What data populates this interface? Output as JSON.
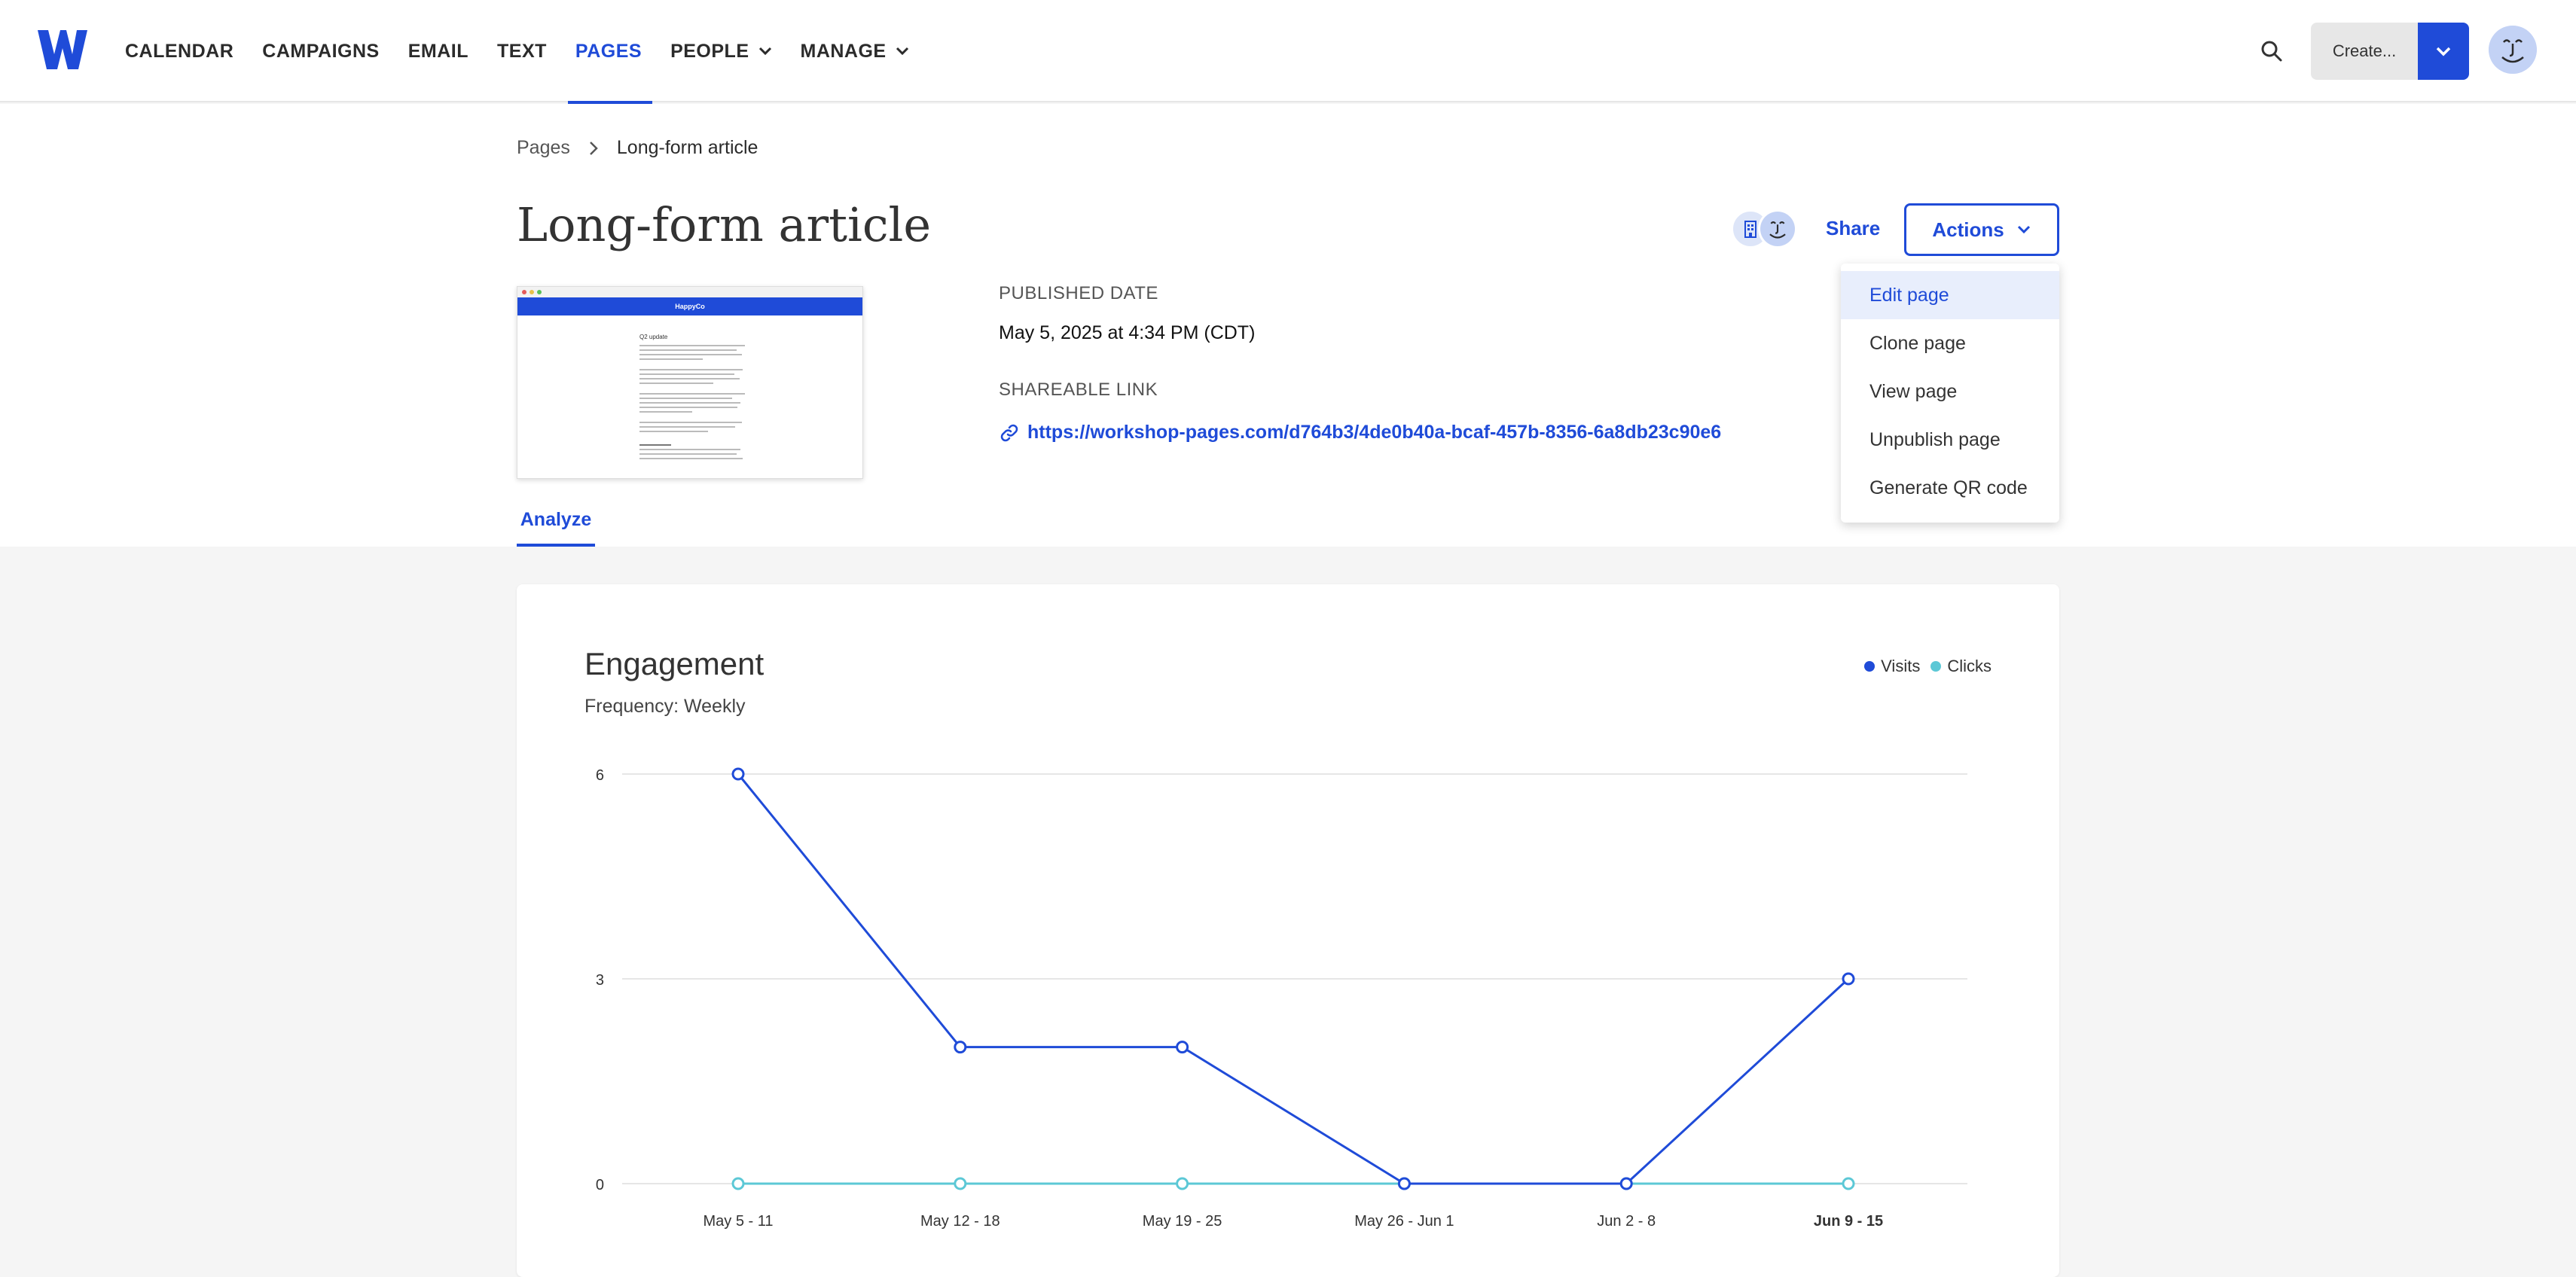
{
  "nav": {
    "items": [
      {
        "label": "CALENDAR",
        "dropdown": false,
        "active": false
      },
      {
        "label": "CAMPAIGNS",
        "dropdown": false,
        "active": false
      },
      {
        "label": "EMAIL",
        "dropdown": false,
        "active": false
      },
      {
        "label": "TEXT",
        "dropdown": false,
        "active": false
      },
      {
        "label": "PAGES",
        "dropdown": false,
        "active": true
      },
      {
        "label": "PEOPLE",
        "dropdown": true,
        "active": false
      },
      {
        "label": "MANAGE",
        "dropdown": true,
        "active": false
      }
    ],
    "create_label": "Create...",
    "search_icon": "search-icon",
    "accent": "#1f4bd8"
  },
  "breadcrumb": {
    "root": "Pages",
    "current": "Long-form article"
  },
  "page": {
    "title": "Long-form article",
    "thumbnail": {
      "brand": "HappyCo",
      "heading": "Q2 update"
    },
    "published_label": "PUBLISHED DATE",
    "published_value": "May 5, 2025 at 4:34 PM (CDT)",
    "link_label": "SHAREABLE LINK",
    "link_value": "https://workshop-pages.com/d764b3/4de0b40a-bcaf-457b-8356-6a8db23c90e6"
  },
  "toolbar": {
    "share_label": "Share",
    "actions_label": "Actions"
  },
  "actions_menu": [
    {
      "label": "Edit page",
      "active": true
    },
    {
      "label": "Clone page",
      "active": false
    },
    {
      "label": "View page",
      "active": false
    },
    {
      "label": "Unpublish page",
      "active": false
    },
    {
      "label": "Generate QR code",
      "active": false
    }
  ],
  "tabs": [
    {
      "label": "Analyze",
      "active": true
    }
  ],
  "engagement": {
    "title": "Engagement",
    "subtitle": "Frequency: Weekly"
  },
  "chart_data": {
    "type": "line",
    "categories": [
      "May 5 - 11",
      "May 12 - 18",
      "May 19 - 25",
      "May 26 - Jun 1",
      "Jun 2 - 8",
      "Jun 9 - 15"
    ],
    "series": [
      {
        "name": "Visits",
        "values": [
          6,
          2,
          2,
          0,
          0,
          3
        ],
        "color": "#1f4bd8"
      },
      {
        "name": "Clicks",
        "values": [
          0,
          0,
          0,
          0,
          0,
          0
        ],
        "color": "#5cc8d6"
      }
    ],
    "yticks": [
      0,
      3,
      6
    ],
    "ylim": [
      0,
      6
    ],
    "bold_category": "Jun 9 - 15",
    "legend": "top-right",
    "grid": true
  }
}
